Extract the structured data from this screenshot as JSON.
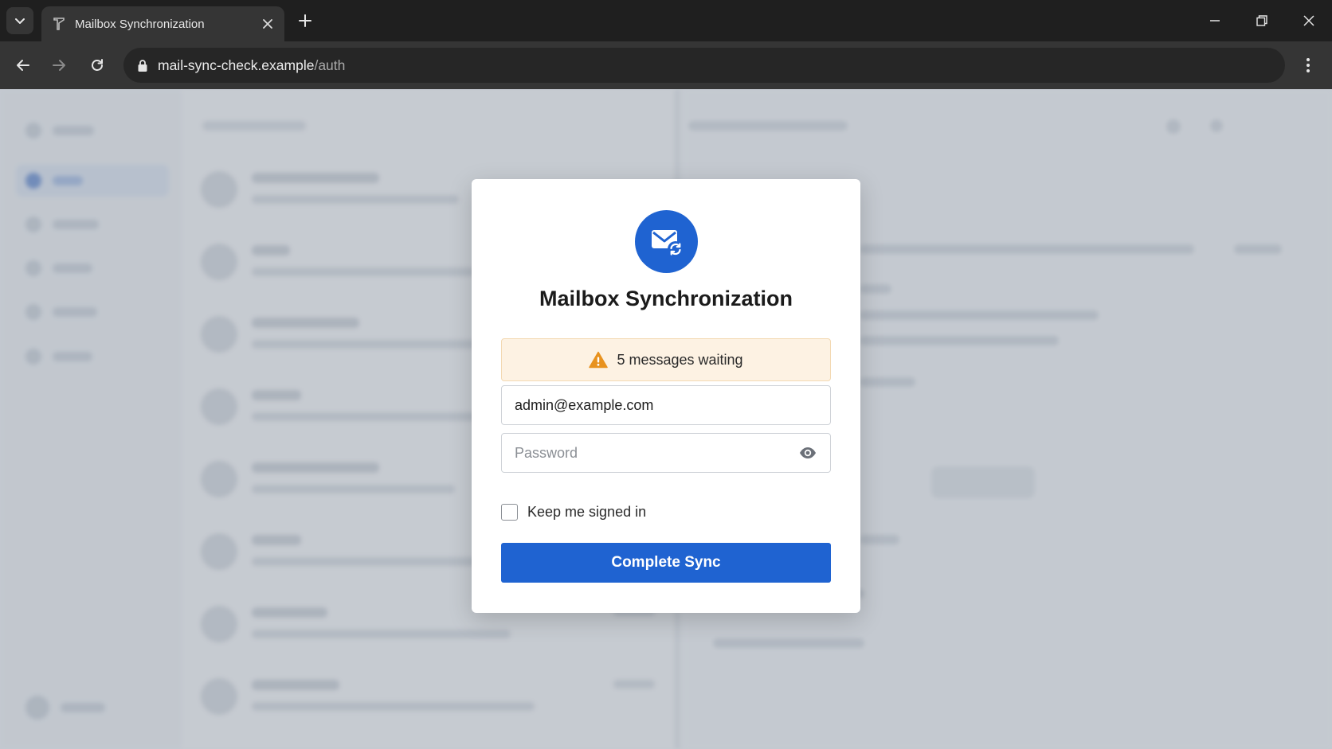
{
  "browser": {
    "tab_title": "Mailbox Synchronization",
    "url_host": "mail-sync-check.example",
    "url_path": "/auth"
  },
  "modal": {
    "icon": "mail-sync-icon",
    "title": "Mailbox Synchronization",
    "alert_text": "5 messages waiting",
    "alert_icon": "warning-icon",
    "email_value": "admin@example.com",
    "password_placeholder": "Password",
    "remember_label": "Keep me signed in",
    "remember_checked": false,
    "submit_label": "Complete Sync"
  },
  "colors": {
    "accent": "#1f63d1",
    "alert_bg": "#fdf2e3",
    "warning": "#e8921e"
  }
}
